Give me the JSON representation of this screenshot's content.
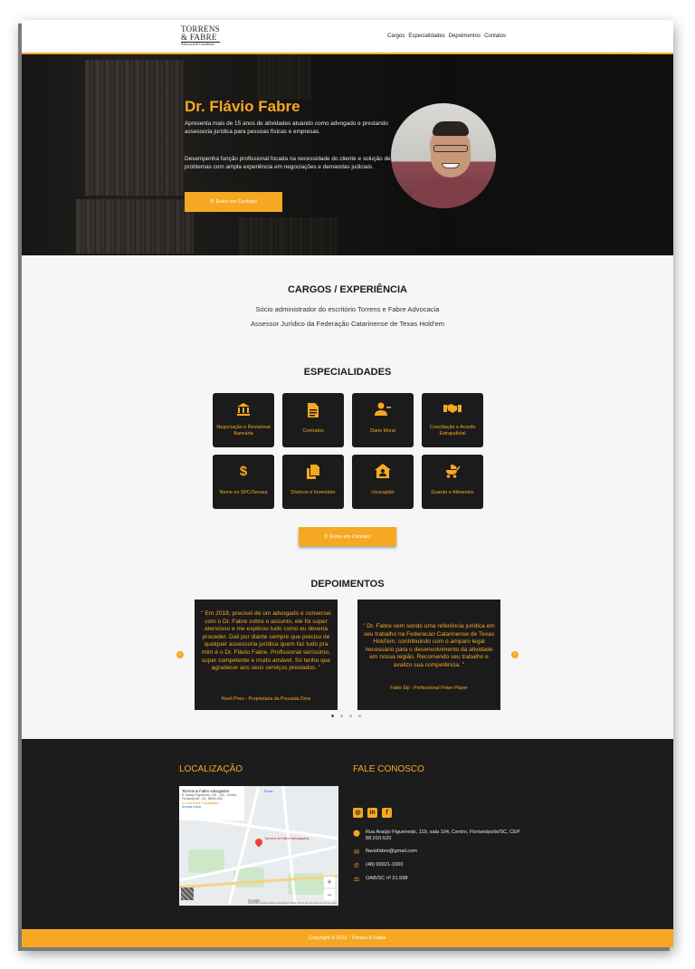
{
  "header": {
    "logo_line1": "TORRENS",
    "logo_line2": "& FABRE",
    "logo_line3": "Advocacia & Consultoria",
    "nav": [
      "Cargos",
      "Especialidades",
      "Depoimentos",
      "Contatos"
    ]
  },
  "hero": {
    "name": "Dr. Flávio Fabre",
    "para1": "Apresenta mais de 15 anos de atividades atuando como advogado e prestando assessoria jurídica para pessoas físicas e empresas.",
    "para2": "Desempenha função profissional focada na necessidade do cliente e solução de problemas com ampla experiência em negociações e demandas judiciais.",
    "cta": "Entre em Contato!"
  },
  "cargos": {
    "title": "CARGOS / EXPERIÊNCIA",
    "items": [
      "Sócio administrador do escritório Torrens e Fabre Advocacia",
      "Assessor Jurídico da Federação Catarinense de Texas Hold'em"
    ]
  },
  "especialidades": {
    "title": "ESPECIALIDADES",
    "cards": [
      {
        "label": "Negociação e Revisional Bancária",
        "icon": "bank-icon"
      },
      {
        "label": "Contratos",
        "icon": "document-icon"
      },
      {
        "label": "Dano Moral",
        "icon": "user-minus-icon"
      },
      {
        "label": "Conciliação e Acordo Extrajudicial",
        "icon": "handshake-icon"
      },
      {
        "label": "Nome no SPC/Serasa",
        "icon": "dollar-icon"
      },
      {
        "label": "Divórcio e Inventário",
        "icon": "copy-document-icon"
      },
      {
        "label": "Usucapião",
        "icon": "house-user-icon"
      },
      {
        "label": "Guarda e Alimentos",
        "icon": "baby-carriage-icon"
      }
    ],
    "cta": "Entre em Contato!"
  },
  "depoimentos": {
    "title": "DEPOIMENTOS",
    "items": [
      {
        "quote": "\" Em 2018, precisei de um advogado e conversei com o Dr. Fabre sobre o assunto, ele foi super atencioso e me explicou tudo como eu deveria proceder. Dali por diante sempre que preciso de qualquer assessoria jurídica quem faz tudo pra mim é o Dr. Flávio Fabre. Profissional seríssimo, super competente e muito amável. Só tenho que agradecer aos seus serviços prestados. \"",
        "author": "Noeli Pires - Proprietária da Pousada Dora"
      },
      {
        "quote": "\" Dr. Fabre vem sendo uma referência jurídica em seu trabalho na Federacao Catarinense de Texas Hold'em, contribuindo com o amparo legal necessário para o desenvolvimento da atividade em nossa região. Recomendo seu trabalho e avalizo sua competência. \"",
        "author": "Fabio Eiji - Professional Poker Player"
      }
    ]
  },
  "footer": {
    "location_title": "LOCALIZAÇÃO",
    "contact_title": "FALE CONOSCO",
    "map": {
      "place": "Torrens & Fabre Advogados",
      "address": "R. Araújo Figueiredo, 119 - 104 - Centro, Florianópolis - SC, 88010-520",
      "rating": "5,0 ★★★★★  3 avaliações",
      "link": "Ampliar mapa",
      "route": "Rotas",
      "pin_label": "Torrens & Fabre Advogados",
      "google": "Google",
      "attribution": "Atalhos do teclado  Dados cartográficos ©2022  Termos de Uso  Informar erro no mapa"
    },
    "address": "Rua Araújo Figueiredo, 119, sala 104, Centro, Florianópolis/SC, CEP 88.010-520",
    "email": "flaviofabre@gmail.com",
    "phone": "(48) 99921-1000",
    "oab": "OAB/SC nº 21.598",
    "copyright": "Copyright © 2022 - Torrens & Fabre"
  },
  "colors": {
    "accent": "#f7a823",
    "dark": "#1b1b1b",
    "background": "#f6f6f6"
  }
}
